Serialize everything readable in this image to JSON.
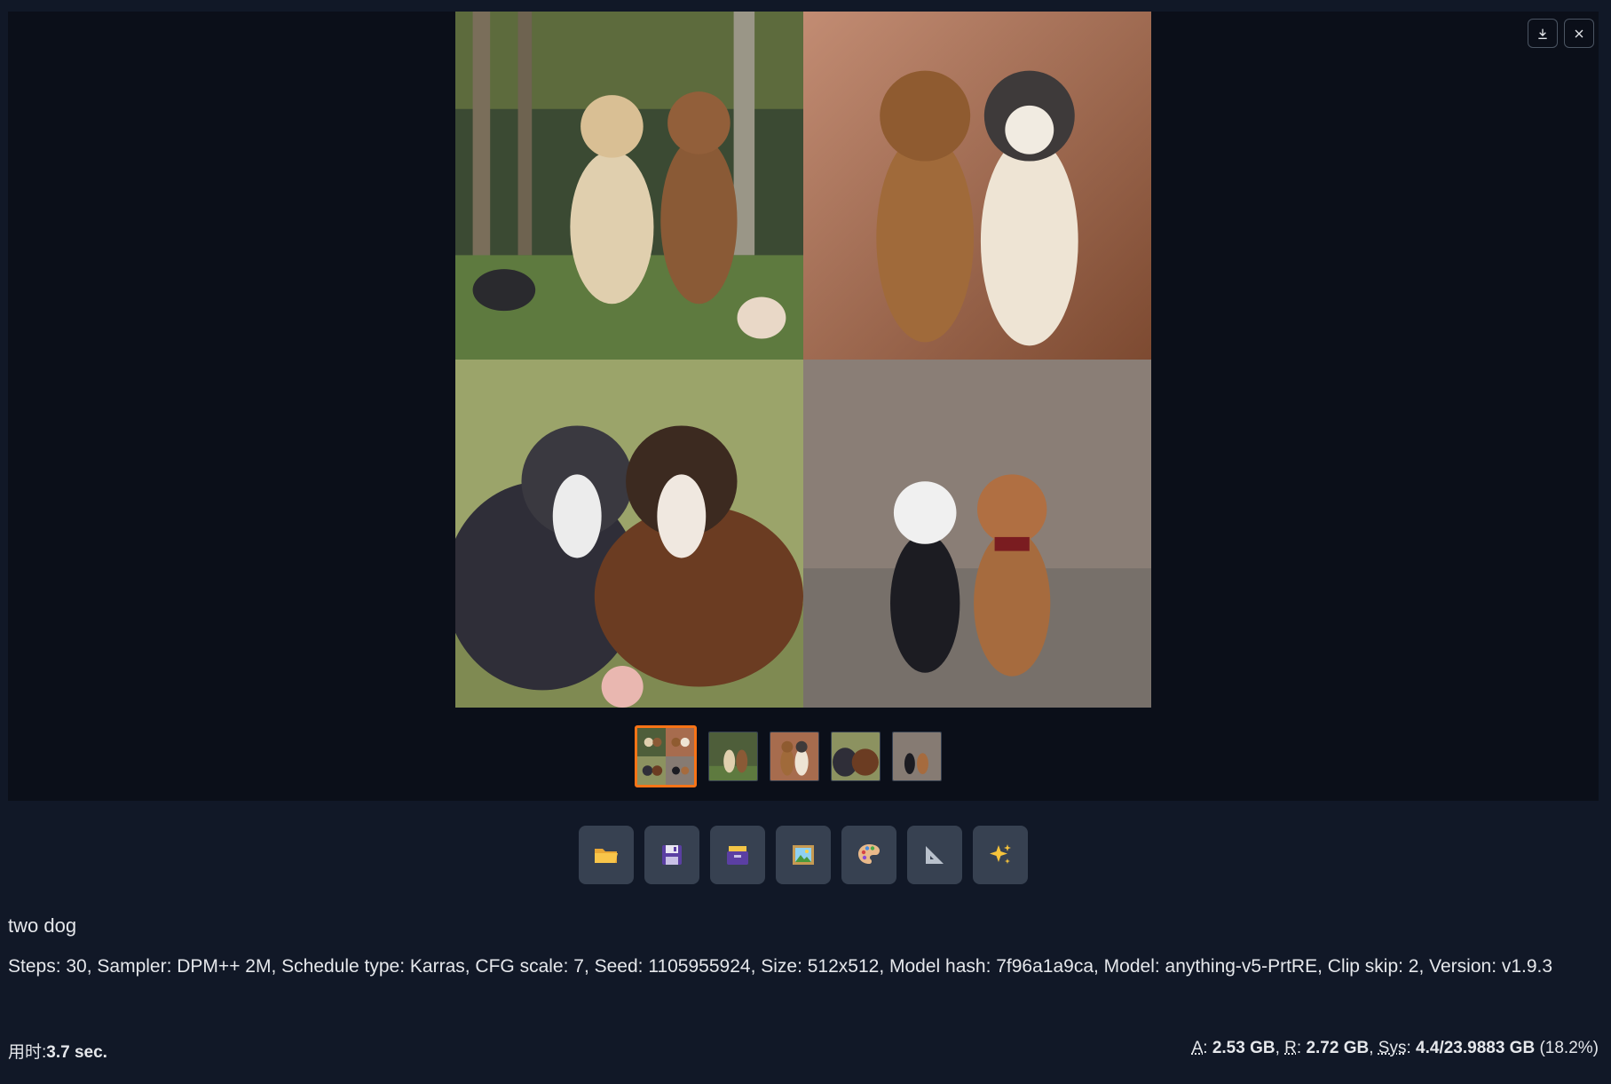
{
  "gallery": {
    "download_icon": "download-icon",
    "close_icon": "close-icon",
    "main_image_description": "2x2 grid of four cartoon dog pairs",
    "thumbnail_count": 5,
    "selected_thumbnail": 1
  },
  "actions": [
    {
      "name": "open-folder-button",
      "icon": "folder-icon",
      "glyph": "📂"
    },
    {
      "name": "save-button",
      "icon": "floppy-disk-icon",
      "glyph": "💾"
    },
    {
      "name": "zip-save-button",
      "icon": "card-index-icon",
      "glyph": "🗃️"
    },
    {
      "name": "send-to-img2img-button",
      "icon": "picture-icon",
      "glyph": "🖼️"
    },
    {
      "name": "send-to-inpaint-button",
      "icon": "palette-icon",
      "glyph": "🎨"
    },
    {
      "name": "send-to-extras-button",
      "icon": "triangle-ruler-icon",
      "glyph": "📐"
    },
    {
      "name": "hires-fix-button",
      "icon": "sparkles-icon",
      "glyph": "✨"
    }
  ],
  "info": {
    "prompt": "two dog",
    "params": "Steps: 30, Sampler: DPM++ 2M, Schedule type: Karras, CFG scale: 7, Seed: 1105955924, Size: 512x512, Model hash: 7f96a1a9ca, Model: anything-v5-PrtRE, Clip skip: 2, Version: v1.9.3"
  },
  "status": {
    "time_label": "用时:",
    "time_value": "3.7 sec.",
    "mem_a_label": "A",
    "mem_a_value": "2.53 GB",
    "mem_r_label": "R",
    "mem_r_value": "2.72 GB",
    "mem_sys_label": "Sys",
    "mem_sys_value": "4.4/23.9883 GB",
    "mem_sys_pct": "(18.2%)"
  },
  "colors": {
    "background": "#111827",
    "gallery_bg": "#0b0f19",
    "button_bg": "#374151",
    "selected_border": "#f97316"
  }
}
